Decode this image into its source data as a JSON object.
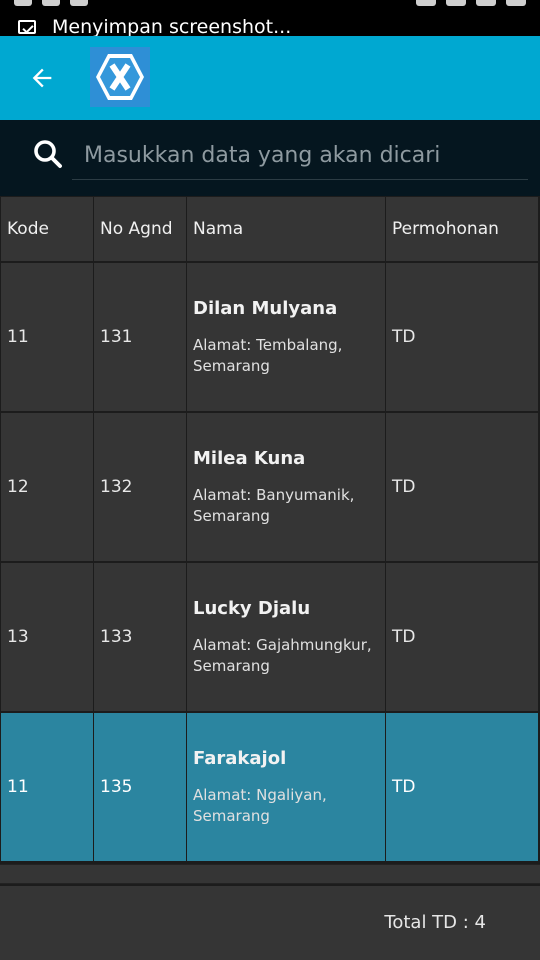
{
  "status_bar": {
    "notification_text": "Menyimpan screenshot..."
  },
  "app_bar": {
    "back_icon": "arrow-left-icon",
    "logo_icon": "xamarin-logo-icon"
  },
  "search": {
    "placeholder": "Masukkan data yang akan dicari",
    "value": ""
  },
  "table": {
    "headers": [
      "Kode",
      "No Agnd",
      "Nama",
      "Permohonan"
    ],
    "rows": [
      {
        "kode": "11",
        "no_agnd": "131",
        "nama": "Dilan Mulyana",
        "alamat": "Alamat: Tembalang, Semarang",
        "permohonan": "TD"
      },
      {
        "kode": "12",
        "no_agnd": "132",
        "nama": "Milea Kuna",
        "alamat": "Alamat: Banyumanik, Semarang",
        "permohonan": "TD"
      },
      {
        "kode": "13",
        "no_agnd": "133",
        "nama": "Lucky Djalu",
        "alamat": "Alamat: Gajahmungkur, Semarang",
        "permohonan": "TD"
      },
      {
        "kode": "11",
        "no_agnd": "135",
        "nama": "Farakajol",
        "alamat": "Alamat: Ngaliyan, Semarang",
        "permohonan": "TD"
      }
    ],
    "selected_row_index": 3
  },
  "footer": {
    "total_text": "Total TD : 4"
  },
  "colors": {
    "app_bar": "#00a8d1",
    "selected_row": "#2b85a0",
    "cell_bg": "#353535"
  }
}
